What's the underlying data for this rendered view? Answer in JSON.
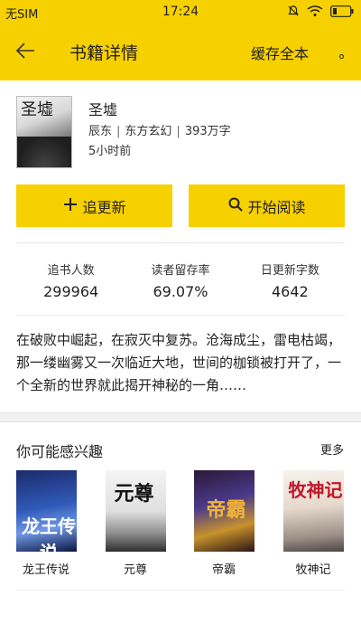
{
  "status_bar": {
    "carrier": "无SIM",
    "time": "17:24"
  },
  "app_bar": {
    "title": "书籍详情",
    "cache_label": "缓存全本"
  },
  "book": {
    "title": "圣墟",
    "author": "辰东",
    "category": "东方玄幻",
    "word_count": "393万字",
    "updated": "5小时前",
    "cover_text": "圣墟"
  },
  "actions": {
    "follow_label": "追更新",
    "read_label": "开始阅读"
  },
  "stats": [
    {
      "label": "追书人数",
      "value": "299964"
    },
    {
      "label": "读者留存率",
      "value": "69.07%"
    },
    {
      "label": "日更新字数",
      "value": "4642"
    }
  ],
  "intro": "在破败中崛起，在寂灭中复苏。沧海成尘，雷电枯竭，那一缕幽雾又一次临近大地，世间的枷锁被打开了，一个全新的世界就此揭开神秘的一角……",
  "recommend": {
    "title": "你可能感兴趣",
    "more_label": "更多",
    "items": [
      {
        "name": "龙王传说",
        "cover_text": "龙王传说"
      },
      {
        "name": "元尊",
        "cover_text": "元尊"
      },
      {
        "name": "帝霸",
        "cover_text": "帝霸"
      },
      {
        "name": "牧神记",
        "cover_text": "牧神记"
      }
    ]
  },
  "colors": {
    "accent": "#f7d000"
  }
}
